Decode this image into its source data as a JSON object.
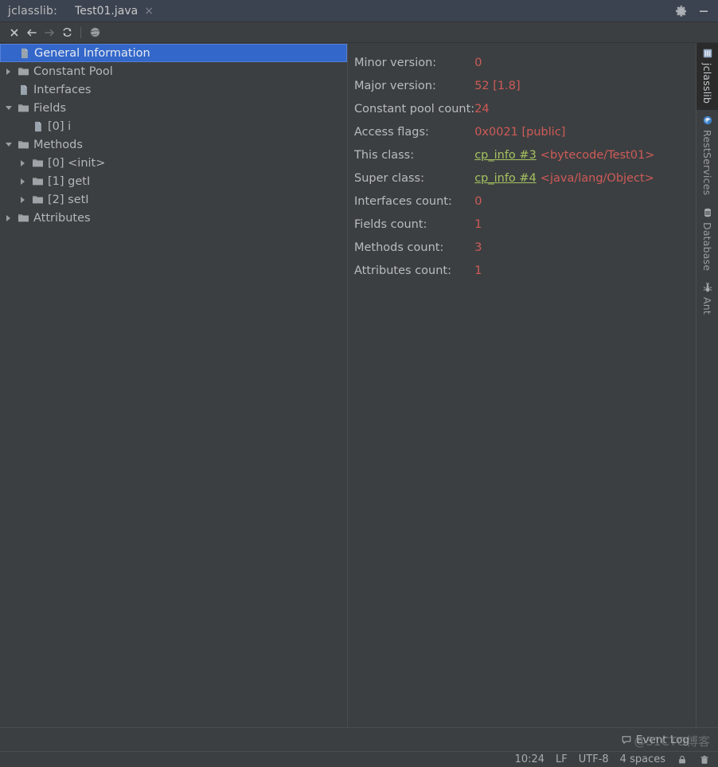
{
  "titlebar": {
    "app_name": "jclasslib:",
    "file_name": "Test01.java",
    "close_tab_glyph": "×",
    "settings_icon": "gear-icon",
    "minimize_icon": "minimize-icon"
  },
  "toolbar": {
    "buttons": [
      {
        "name": "close-button",
        "glyph": "✕",
        "enabled": true
      },
      {
        "name": "back-button",
        "glyph": "←",
        "enabled": true
      },
      {
        "name": "forward-button",
        "glyph": "→",
        "enabled": false
      },
      {
        "name": "reload-button",
        "glyph": "↻",
        "enabled": true
      },
      {
        "name": "browse-button",
        "glyph": "globe",
        "enabled": true
      }
    ]
  },
  "tree": {
    "items": [
      {
        "label": "General Information",
        "indent": 0,
        "twisty": "none",
        "icon": "class-file-icon",
        "selected": true
      },
      {
        "label": "Constant Pool",
        "indent": 0,
        "twisty": "right",
        "icon": "folder-icon",
        "selected": false
      },
      {
        "label": "Interfaces",
        "indent": 0,
        "twisty": "none",
        "icon": "class-file-icon",
        "selected": false
      },
      {
        "label": "Fields",
        "indent": 0,
        "twisty": "down",
        "icon": "folder-icon",
        "selected": false
      },
      {
        "label": "[0] i",
        "indent": 1,
        "twisty": "none",
        "icon": "class-file-icon",
        "selected": false
      },
      {
        "label": "Methods",
        "indent": 0,
        "twisty": "down",
        "icon": "folder-icon",
        "selected": false
      },
      {
        "label": "[0] <init>",
        "indent": 1,
        "twisty": "right",
        "icon": "folder-icon",
        "selected": false
      },
      {
        "label": "[1] getI",
        "indent": 1,
        "twisty": "right",
        "icon": "folder-icon",
        "selected": false
      },
      {
        "label": "[2] setI",
        "indent": 1,
        "twisty": "right",
        "icon": "folder-icon",
        "selected": false
      },
      {
        "label": "Attributes",
        "indent": 0,
        "twisty": "right",
        "icon": "folder-icon",
        "selected": false
      }
    ]
  },
  "detail": {
    "rows": [
      {
        "label": "Minor version:",
        "value": "0",
        "link": null,
        "link_desc": null
      },
      {
        "label": "Major version:",
        "value": "52 [1.8]",
        "link": null,
        "link_desc": null
      },
      {
        "label": "Constant pool count:",
        "value": "24",
        "link": null,
        "link_desc": null
      },
      {
        "label": "Access flags:",
        "value": "0x0021 [public]",
        "link": null,
        "link_desc": null
      },
      {
        "label": "This class:",
        "value": null,
        "link": "cp_info #3",
        "link_desc": "<bytecode/Test01>"
      },
      {
        "label": "Super class:",
        "value": null,
        "link": "cp_info #4",
        "link_desc": "<java/lang/Object>"
      },
      {
        "label": "Interfaces count:",
        "value": "0",
        "link": null,
        "link_desc": null
      },
      {
        "label": "Fields count:",
        "value": "1",
        "link": null,
        "link_desc": null
      },
      {
        "label": "Methods count:",
        "value": "3",
        "link": null,
        "link_desc": null
      },
      {
        "label": "Attributes count:",
        "value": "1",
        "link": null,
        "link_desc": null
      }
    ]
  },
  "rightbar": {
    "tabs": [
      {
        "label": "jclasslib",
        "icon": "grid-icon",
        "active": true
      },
      {
        "label": "RestServices",
        "icon": "rest-icon",
        "active": false
      },
      {
        "label": "Database",
        "icon": "database-icon",
        "active": false
      },
      {
        "label": "Ant",
        "icon": "ant-icon",
        "active": false
      }
    ]
  },
  "status": {
    "event_log": "Event Log",
    "time": "10:24",
    "line_separator": "LF",
    "encoding": "UTF-8",
    "indent": "4 spaces",
    "lock_icon": "lock-icon",
    "trash_icon": "trash-icon"
  },
  "watermark": {
    "text": "@51CTO博客"
  },
  "colors": {
    "accent_selection": "#3367ca",
    "value_red": "#cf5b58",
    "link_green": "#a5c261",
    "panel_bg": "#3c3f41",
    "titlebar_bg": "#3c4350"
  }
}
